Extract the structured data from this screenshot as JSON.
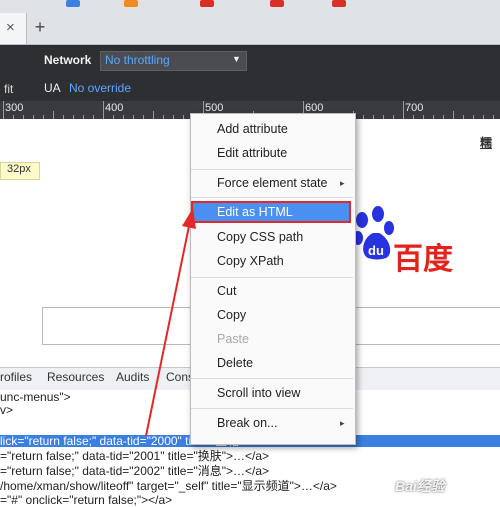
{
  "browser": {
    "new_tab_symbol": "+",
    "tab_close_symbol": "×"
  },
  "emulation": {
    "fit_label": "fit",
    "network_label": "Network",
    "network_value": "No throttling",
    "ua_label": "UA",
    "ua_value": "No override"
  },
  "ruler": {
    "labels": [
      "300",
      "400",
      "500",
      "600",
      "700"
    ]
  },
  "page": {
    "size_badge": "32px",
    "top_link": "糯",
    "logo_text": "百度"
  },
  "devtools": {
    "tabs": [
      "rofiles",
      "Resources",
      "Audits",
      "Cons"
    ],
    "lines": [
      "unc-menus\">",
      "v>",
      "lick=\"return false;\" data-tid=\"2000\" title=\"宝箱\">…</a>",
      "=\"return false;\" data-tid=\"2001\" title=\"换肤\">…</a>",
      "=\"return false;\" data-tid=\"2002\" title=\"消息\">…</a>",
      "/home/xman/show/liteoff\" target=\"_self\" title=\"显示频道\">…</a>",
      "=\"#\" onclick=\"return false;\"></a>"
    ]
  },
  "context_menu": {
    "items": [
      {
        "label": "Add attribute"
      },
      {
        "label": "Edit attribute"
      },
      {
        "label": "Force element state"
      },
      {
        "label": "Edit as HTML"
      },
      {
        "label": "Copy CSS path"
      },
      {
        "label": "Copy XPath"
      },
      {
        "label": "Cut"
      },
      {
        "label": "Copy"
      },
      {
        "label": "Paste"
      },
      {
        "label": "Delete"
      },
      {
        "label": "Scroll into view"
      },
      {
        "label": "Break on..."
      }
    ],
    "submenu_arrow": "▸"
  },
  "watermark": "Bai经验",
  "colors": {
    "highlight": "#4a8ff2",
    "annotation_red": "#e32828",
    "selection": "#3b7fe0",
    "logo_red": "#e1231b",
    "logo_blue": "#2932e1"
  }
}
